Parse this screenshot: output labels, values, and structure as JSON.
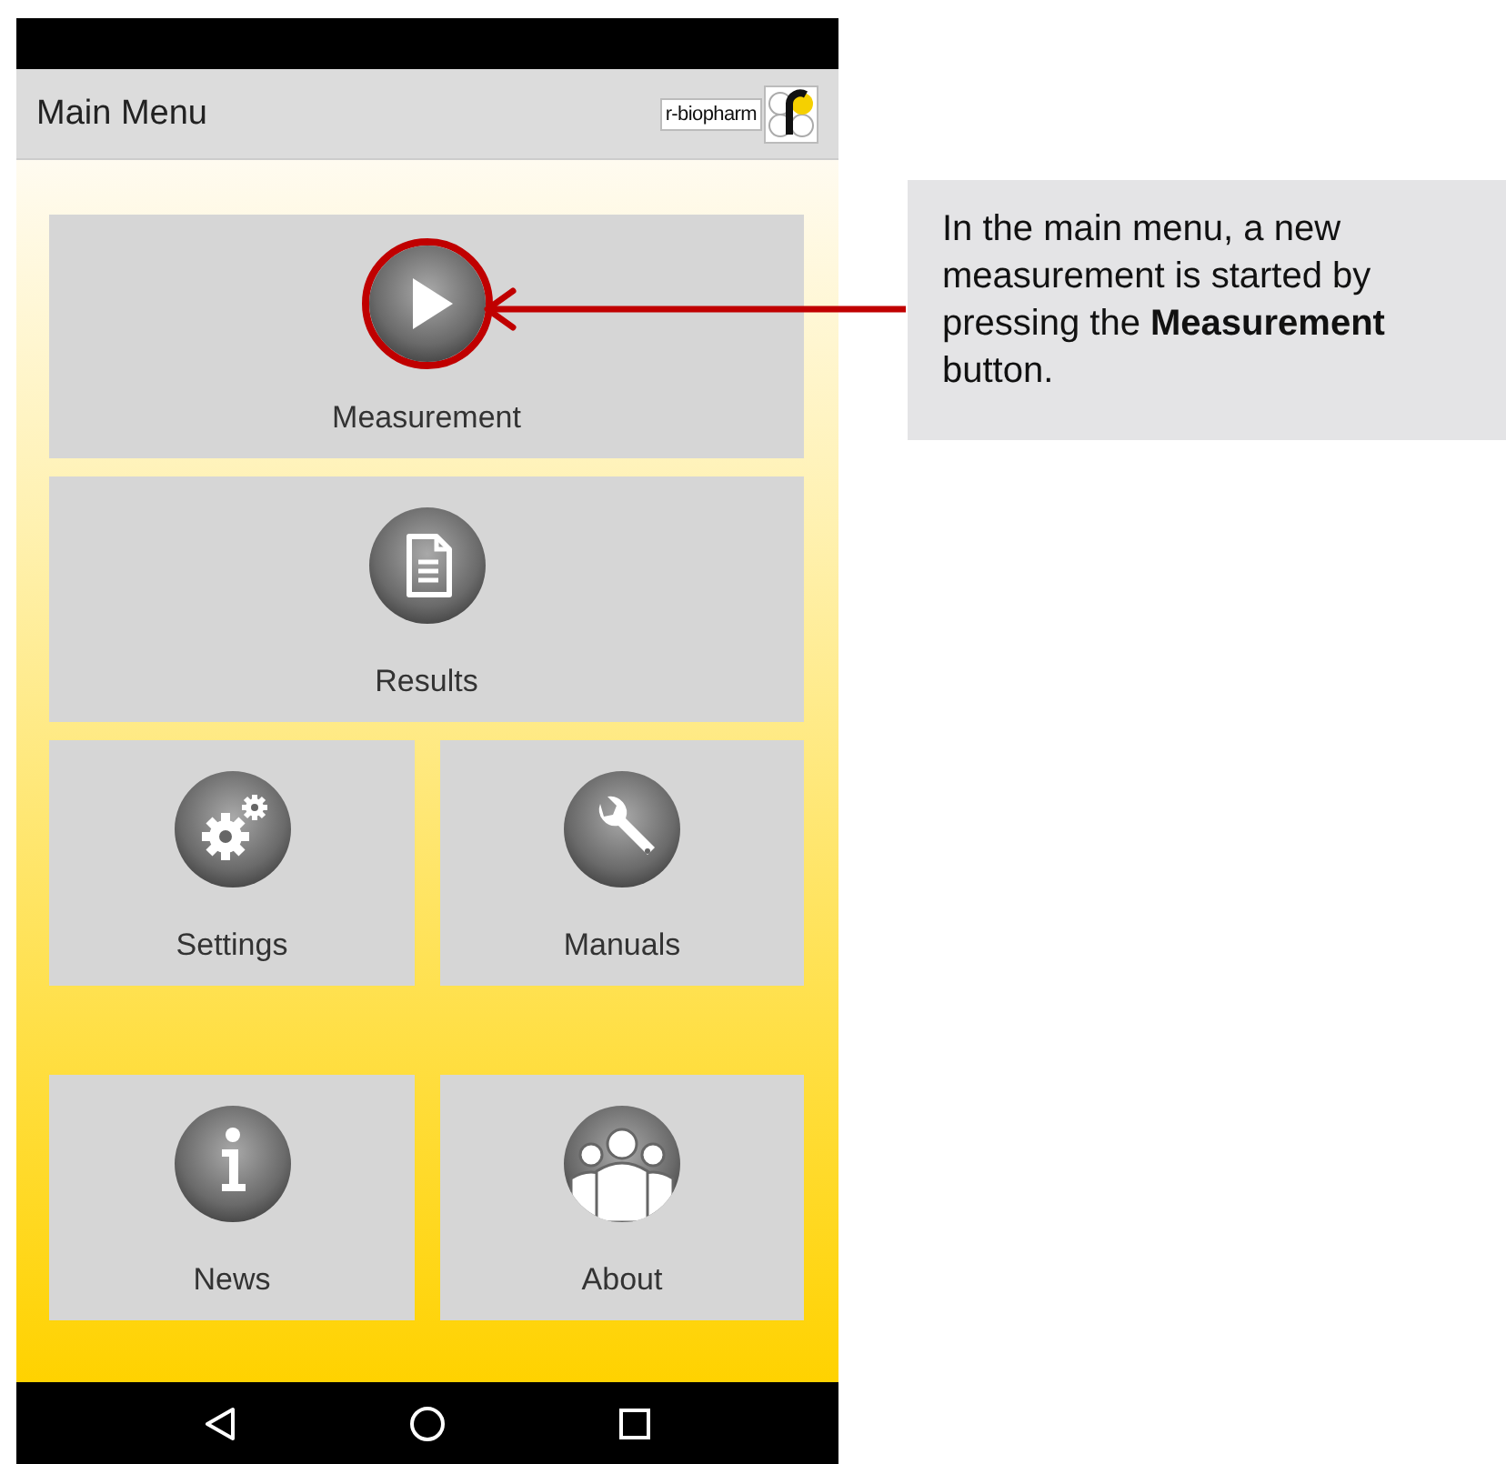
{
  "app_bar": {
    "title": "Main Menu",
    "logo_text": "r-biopharm"
  },
  "tiles": [
    {
      "label": "Measurement",
      "wide": true,
      "highlighted": true
    },
    {
      "label": "Results",
      "wide": true,
      "highlighted": false
    },
    {
      "label": "Settings",
      "wide": false,
      "highlighted": false
    },
    {
      "label": "Manuals",
      "wide": false,
      "highlighted": false
    },
    {
      "label": "News",
      "wide": false,
      "highlighted": false
    },
    {
      "label": "About",
      "wide": false,
      "highlighted": false
    }
  ],
  "callout": {
    "text": "In the main menu, a new measurement is started by pressing the **Measurement** button."
  }
}
